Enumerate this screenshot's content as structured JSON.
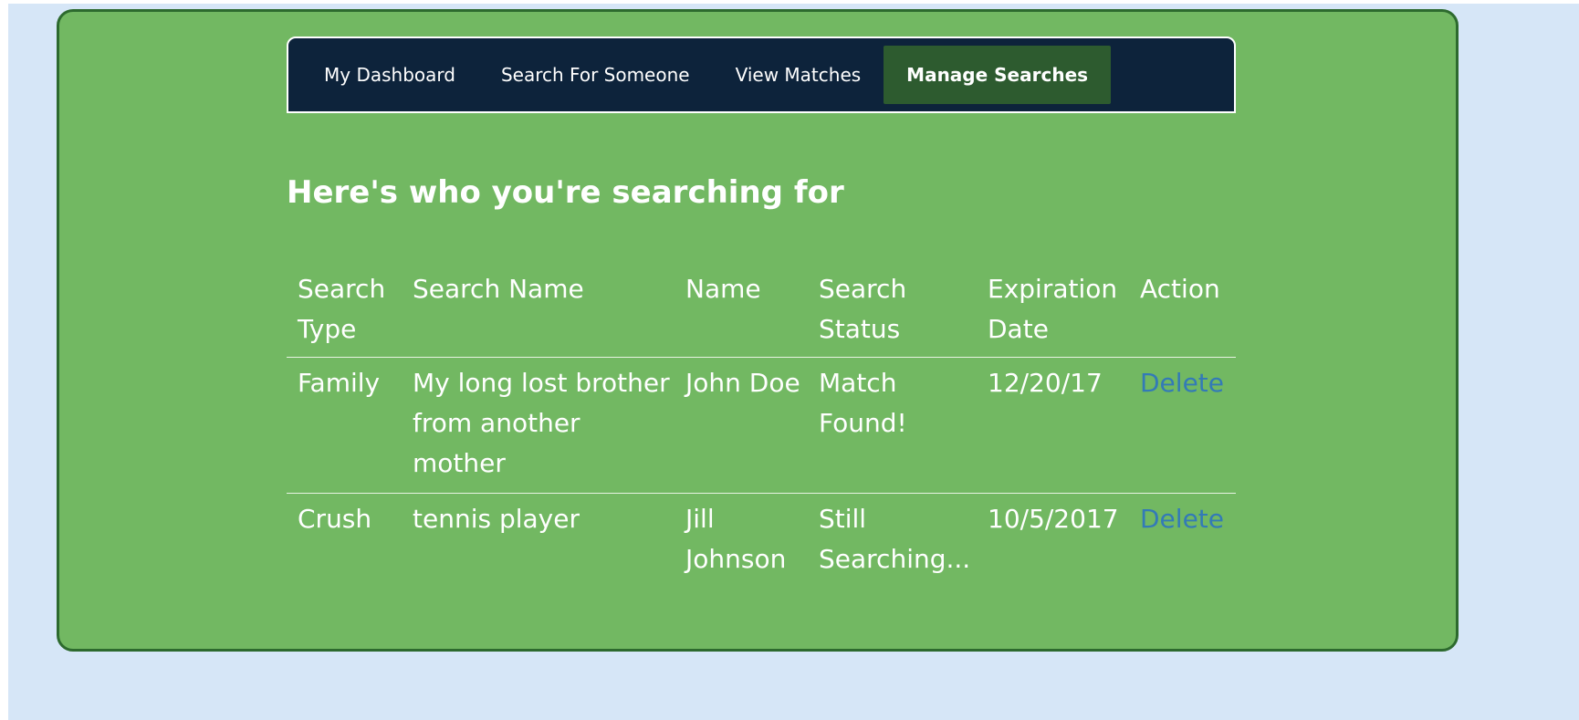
{
  "nav": {
    "items": [
      {
        "label": "My Dashboard",
        "active": false
      },
      {
        "label": "Search For Someone",
        "active": false
      },
      {
        "label": "View Matches",
        "active": false
      },
      {
        "label": "Manage Searches",
        "active": true
      }
    ]
  },
  "page": {
    "title": "Here's who you're searching for"
  },
  "table": {
    "headers": [
      "Search Type",
      "Search Name",
      "Name",
      "Search Status",
      "Expiration Date",
      "Action"
    ],
    "rows": [
      {
        "search_type": "Family",
        "search_name": "My long lost brother from another mother",
        "name": "John Doe",
        "status": "Match Found!",
        "expiration": "12/20/17",
        "action": "Delete"
      },
      {
        "search_type": "Crush",
        "search_name": "tennis player",
        "name": "Jill Johnson",
        "status": "Still Searching...",
        "expiration": "10/5/2017",
        "action": "Delete"
      }
    ]
  },
  "colors": {
    "page_background": "#d6e6f7",
    "card_background": "#72b862",
    "card_border": "#2d6a2e",
    "nav_background": "#0d233b",
    "nav_active": "#2d5b2f",
    "link": "#337ab7"
  }
}
